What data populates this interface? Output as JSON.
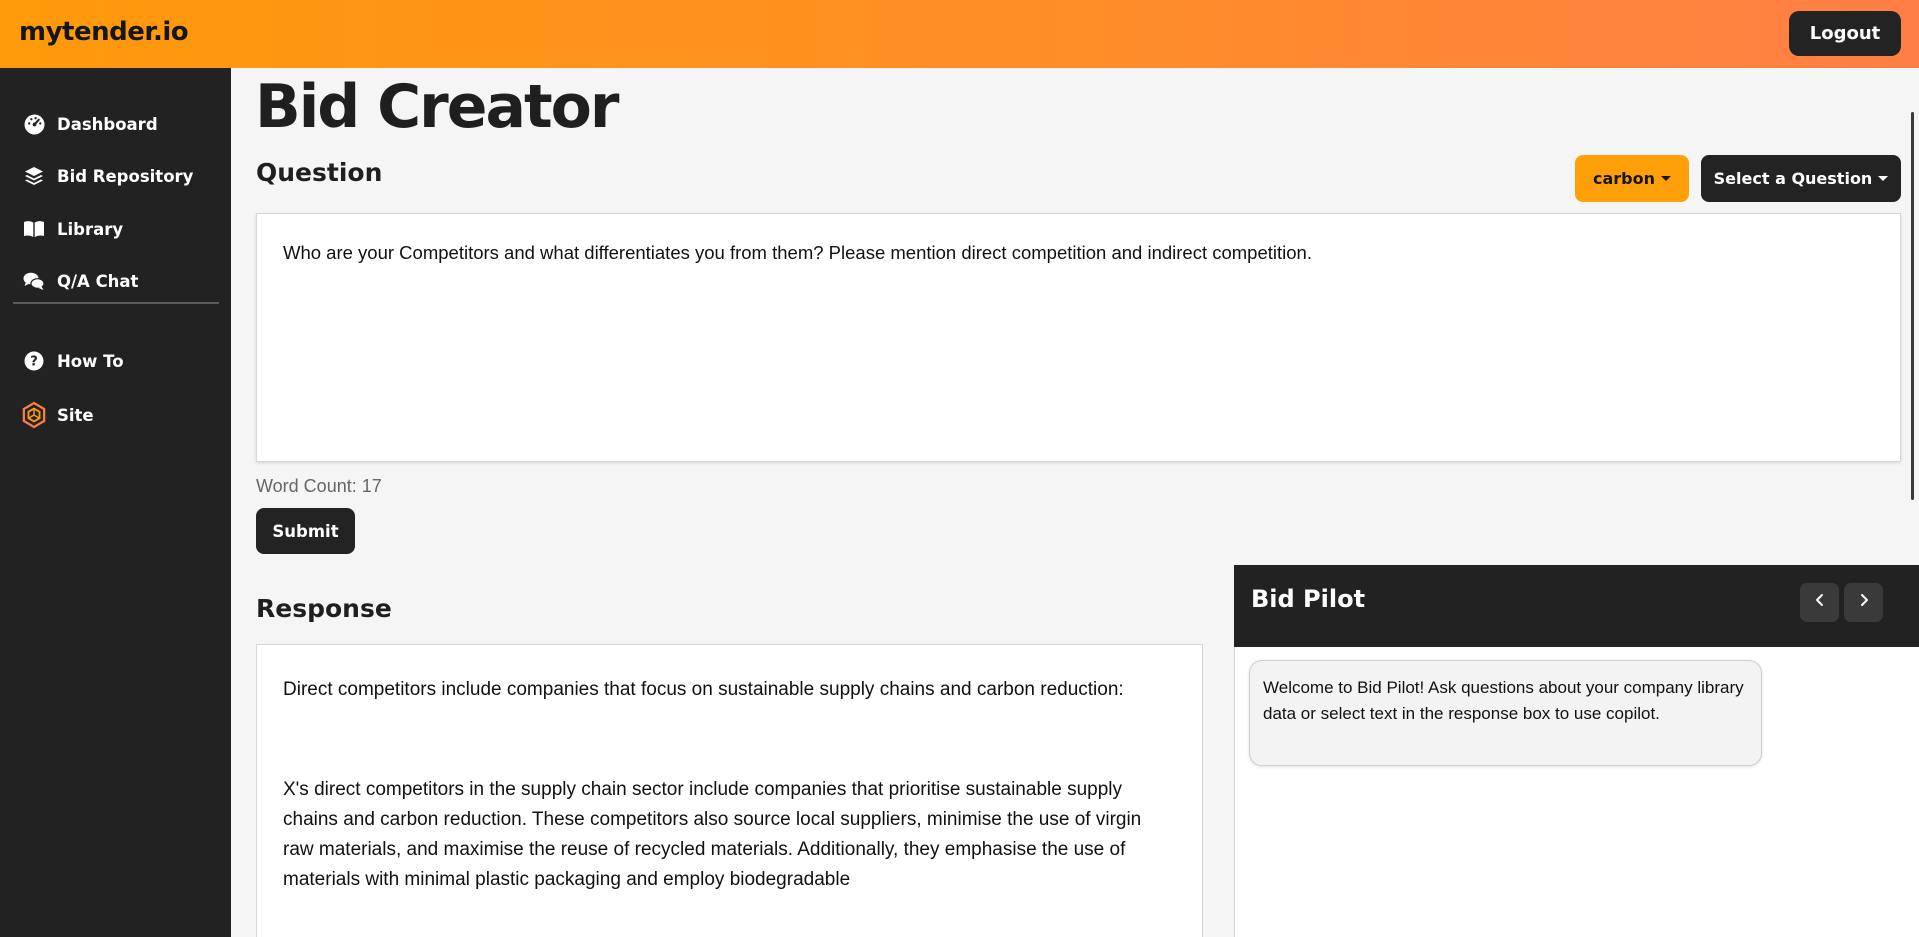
{
  "header": {
    "brand": "mytender.io",
    "logout_label": "Logout"
  },
  "sidebar": {
    "items": [
      {
        "label": "Dashboard",
        "icon": "dashboard-gauge-icon"
      },
      {
        "label": "Bid Repository",
        "icon": "layers-icon"
      },
      {
        "label": "Library",
        "icon": "book-icon"
      },
      {
        "label": "Q/A Chat",
        "icon": "chat-icon"
      },
      {
        "label": "How To",
        "icon": "question-circle-icon"
      },
      {
        "label": "Site",
        "icon": "site-logo-icon"
      }
    ]
  },
  "main": {
    "page_title": "Bid Creator",
    "question_heading": "Question",
    "folder_dropdown_label": "carbon",
    "select_question_label": "Select a Question",
    "question_text": "Who are your Competitors and what differentiates you from them? Please mention direct competition and indirect competition.",
    "word_count": "Word Count: 17",
    "submit_label": "Submit",
    "response_heading": "Response",
    "response_paragraphs": [
      "Direct competitors include companies that focus on sustainable supply chains and carbon reduction:",
      "X's direct competitors in the supply chain sector include companies that prioritise sustainable supply chains and carbon reduction. These competitors also source local suppliers, minimise the use of virgin raw materials, and maximise the reuse of recycled materials. Additionally, they emphasise the use of materials with minimal plastic packaging and employ biodegradable"
    ]
  },
  "bid_pilot": {
    "title": "Bid Pilot",
    "welcome_message": "Welcome to Bid Pilot! Ask questions about your company library data or select text in the response box to use copilot."
  },
  "colors": {
    "header_gradient_start": "#ff9a0a",
    "header_gradient_end": "#ff7e45",
    "sidebar_bg": "#222222",
    "accent_orange": "#ffa00a",
    "dark_button": "#232323"
  }
}
